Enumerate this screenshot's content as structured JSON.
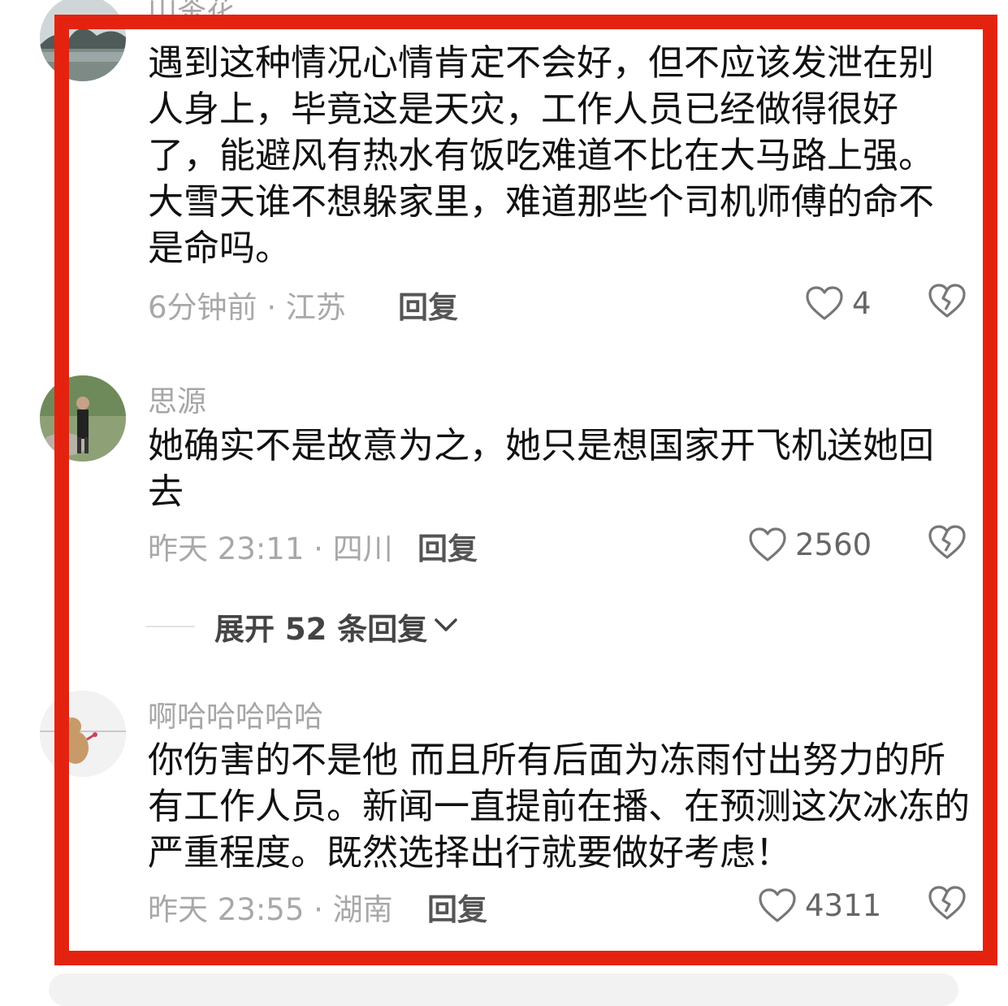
{
  "comments": [
    {
      "username": "山茶花",
      "text": "遇到这种情况心情肯定不会好，但不应该发泄在别人身上，毕竟这是天灾，工作人员已经做得很好了，能避风有热水有饭吃难道不比在大马路上强。大雪天谁不想躲家里，难道那些个司机师傅的命不是命吗。",
      "time": "6分钟前",
      "location": "江苏",
      "reply_label": "回复",
      "likes": "4"
    },
    {
      "username": "思源",
      "text": "她确实不是故意为之，她只是想国家开飞机送她回去",
      "time": "昨天 23:11",
      "location": "四川",
      "reply_label": "回复",
      "likes": "2560"
    },
    {
      "username": "啊哈哈哈哈哈",
      "text": "你伤害的不是他 而且所有后面为冻雨付出努力的所有工作人员。新闻一直提前在播、在预测这次冰冻的严重程度。既然选择出行就要做好考虑！",
      "time": "昨天 23:55",
      "location": "湖南",
      "reply_label": "回复",
      "likes": "4311"
    }
  ],
  "expand_replies": "展开 52 条回复",
  "meta_separator": "·",
  "colors": {
    "highlight_border": "#e3230f",
    "meta_text": "#a8a8a8",
    "username": "#a6a6a6"
  },
  "icons": {
    "like": "heart-outline-icon",
    "dislike": "broken-heart-icon",
    "expand": "chevron-down-icon"
  }
}
